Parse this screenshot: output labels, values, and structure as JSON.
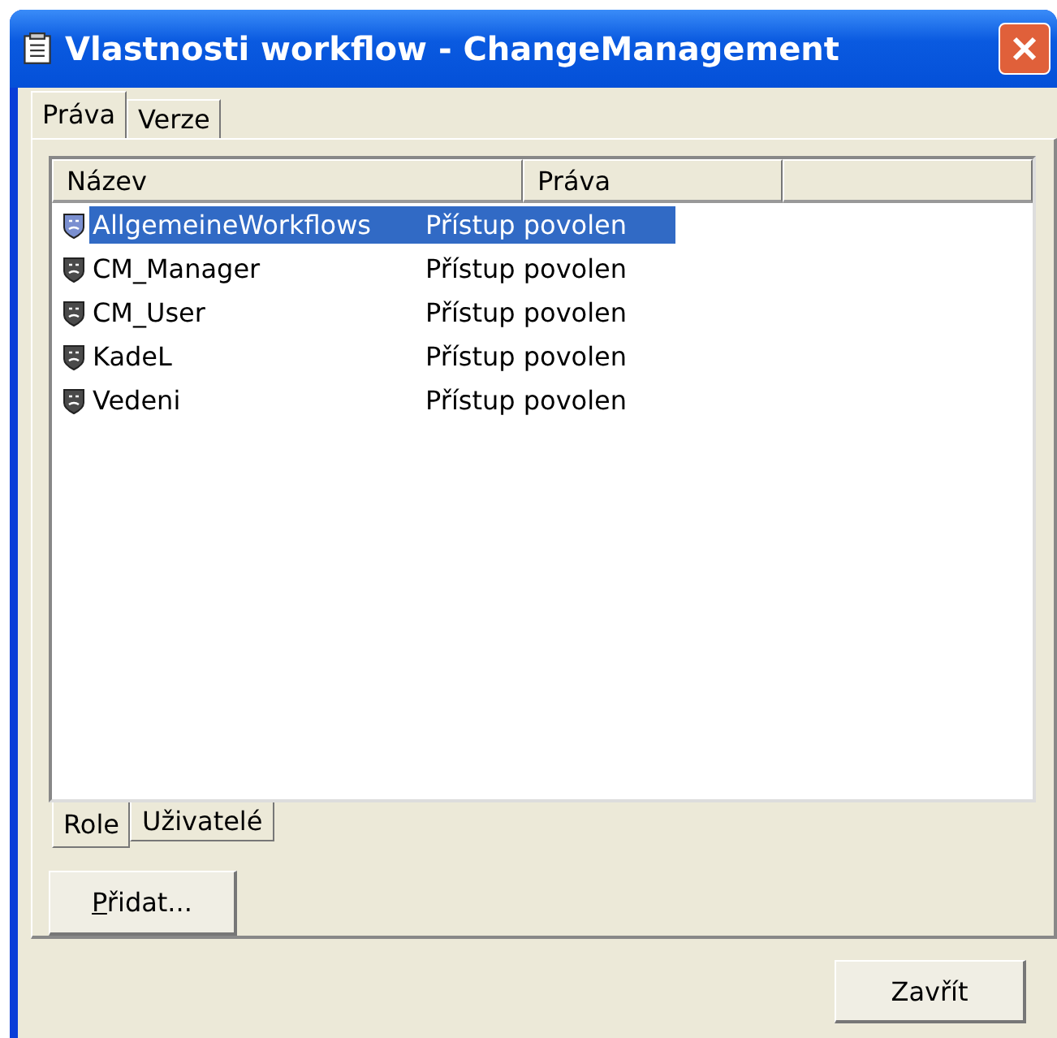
{
  "window": {
    "title": "Vlastnosti workflow - ChangeManagement"
  },
  "tabs": [
    {
      "label": "Práva",
      "selected": true
    },
    {
      "label": "Verze",
      "selected": false
    }
  ],
  "table": {
    "columns": [
      "Název",
      "Práva"
    ],
    "rows": [
      {
        "name": "AllgemeineWorkflows",
        "rights": "Přístup povolen",
        "selected": true
      },
      {
        "name": "CM_Manager",
        "rights": "Přístup povolen",
        "selected": false
      },
      {
        "name": "CM_User",
        "rights": "Přístup povolen",
        "selected": false
      },
      {
        "name": "KadeL",
        "rights": "Přístup povolen",
        "selected": false
      },
      {
        "name": "Vedeni",
        "rights": "Přístup povolen",
        "selected": false
      }
    ]
  },
  "bottom_tabs": [
    {
      "label": "Role",
      "selected": true
    },
    {
      "label": "Uživatelé",
      "selected": false
    }
  ],
  "add_button": {
    "label": "Přidat..."
  },
  "close_button": "Zavřít"
}
